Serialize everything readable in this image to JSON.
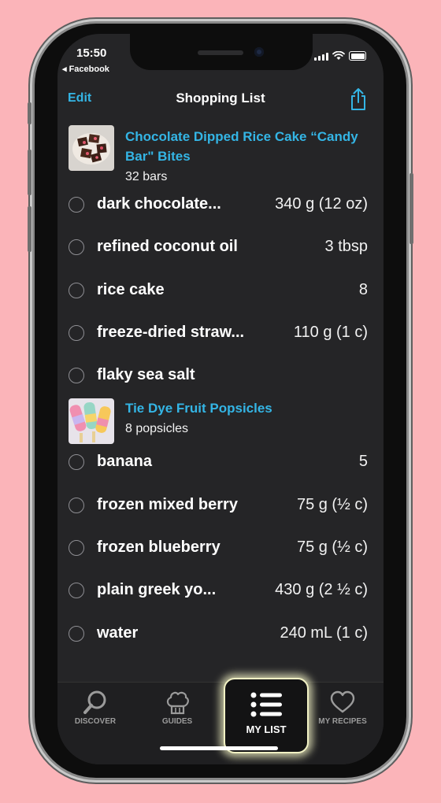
{
  "status": {
    "time": "15:50",
    "back_label": "◂ Facebook"
  },
  "nav": {
    "edit_label": "Edit",
    "title": "Shopping List"
  },
  "recipes": [
    {
      "name": "Chocolate Dipped Rice Cake “Candy Bar\" Bites",
      "yield": "32 bars",
      "items": [
        {
          "name": "dark chocolate...",
          "qty": "340 g (12 oz)"
        },
        {
          "name": "refined coconut oil",
          "qty": "3 tbsp"
        },
        {
          "name": "rice cake",
          "qty": "8"
        },
        {
          "name": "freeze-dried straw...",
          "qty": "110 g (1 c)"
        },
        {
          "name": "flaky sea salt",
          "qty": ""
        }
      ]
    },
    {
      "name": "Tie Dye Fruit Popsicles",
      "yield": "8 popsicles",
      "items": [
        {
          "name": "banana",
          "qty": "5"
        },
        {
          "name": "frozen mixed berry",
          "qty": "75 g (½ c)"
        },
        {
          "name": "frozen blueberry",
          "qty": "75 g (½ c)"
        },
        {
          "name": "plain greek yo...",
          "qty": "430 g (2 ½ c)"
        },
        {
          "name": "water",
          "qty": "240 mL (1 c)"
        }
      ]
    }
  ],
  "tabs": {
    "discover": "DISCOVER",
    "guides": "GUIDES",
    "my_list": "MY LIST",
    "my_recipes": "MY RECIPES"
  },
  "colors": {
    "accent": "#34b5e5",
    "background": "#fbb4b9",
    "screen": "#252527"
  }
}
